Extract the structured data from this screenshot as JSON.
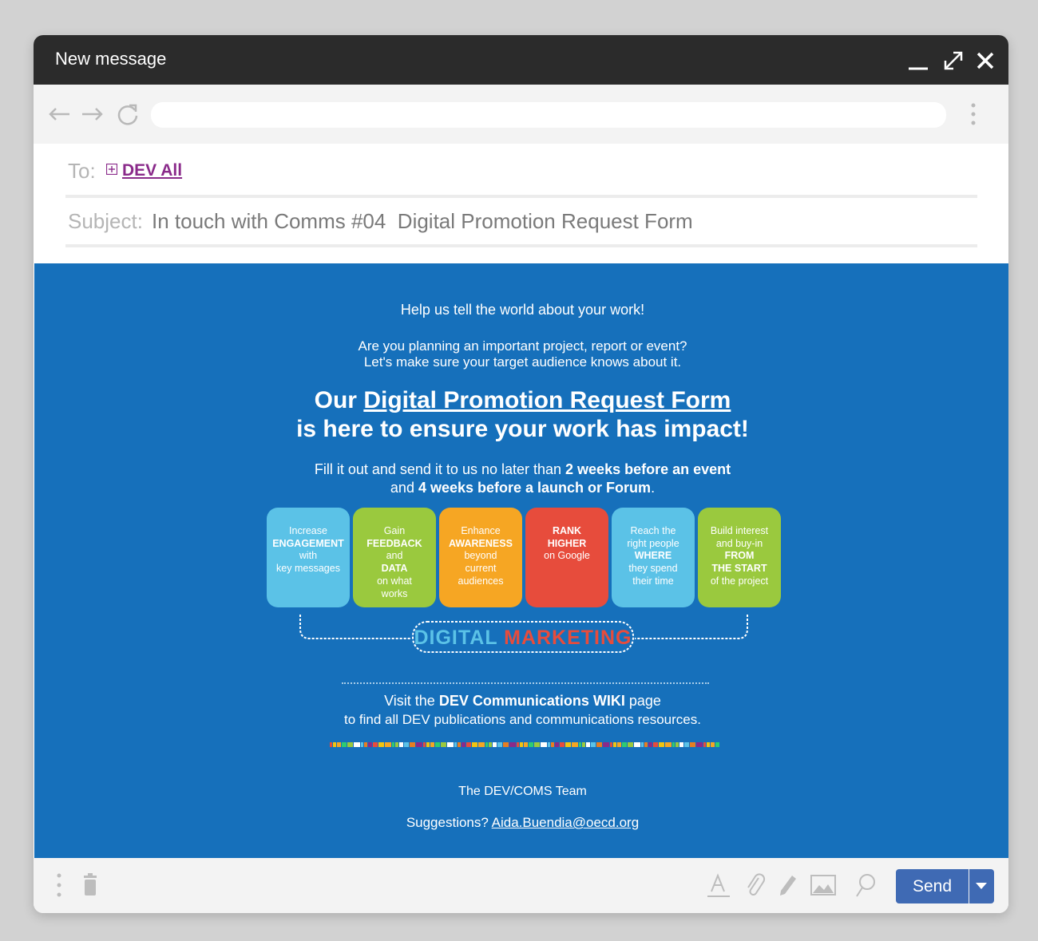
{
  "window": {
    "title": "New message",
    "minimize_icon": "minimize-icon",
    "maximize_icon": "expand-icon",
    "close_icon": "close-icon"
  },
  "nav": {
    "back_icon": "arrow-left-icon",
    "forward_icon": "arrow-right-icon",
    "reload_icon": "reload-icon",
    "address_value": "",
    "more_icon": "kebab-menu-icon"
  },
  "header": {
    "to_label": "To:",
    "recipient": "DEV All",
    "subject_label": "Subject:",
    "subject": "In touch with Comms #04  Digital Promotion Request Form"
  },
  "message": {
    "intro": "Help us tell the world about your work!",
    "question_line1": "Are you planning an important project, report or event?",
    "question_line2": "Let's make sure your target audience knows about it.",
    "headline_prefix": "Our ",
    "headline_link": "Digital Promotion Request Form",
    "headline_line2": "is here to ensure your work has impact!",
    "deadline_line1_pre": "Fill it out and send it to us no later than ",
    "deadline_line1_bold": "2 weeks before an event",
    "deadline_line2_pre": "and ",
    "deadline_line2_bold": "4 weeks before a launch or Forum",
    "deadline_line2_post": ".",
    "cards": [
      {
        "color": "#5bc2e7",
        "lines": [
          "Increase",
          "ENGAGEMENT",
          "with",
          "key messages"
        ]
      },
      {
        "color": "#9ac93e",
        "lines": [
          "Gain",
          "FEEDBACK",
          "and",
          "DATA",
          "on what",
          "works"
        ]
      },
      {
        "color": "#f6a623",
        "lines": [
          "Enhance",
          "AWARENESS",
          "beyond",
          "current",
          "audiences"
        ]
      },
      {
        "color": "#e74c3c",
        "lines": [
          "RANK",
          "HIGHER",
          "on Google"
        ]
      },
      {
        "color": "#5bc2e7",
        "lines": [
          "Reach the",
          "right people",
          "WHERE",
          "they spend",
          "their time"
        ]
      },
      {
        "color": "#9ac93e",
        "lines": [
          "Build interest",
          "and buy-in",
          "FROM",
          "THE START",
          "of the project"
        ]
      }
    ],
    "banner_word1": "DIGITAL",
    "banner_word2": "MARKETING",
    "visit_pre": "Visit the ",
    "visit_bold": "DEV Communications WIKI",
    "visit_post": " page",
    "visit_line2": "to find all DEV publications and communications resources.",
    "signature": "The DEV/COMS Team",
    "suggestions_label": "Suggestions? ",
    "suggestions_email": "Aida.Buendia@oecd.org"
  },
  "footer": {
    "more_icon": "vertical-dots-icon",
    "trash_icon": "trash-icon",
    "format_icon": "text-format-icon",
    "attach_icon": "paperclip-icon",
    "pen_icon": "pen-icon",
    "image_icon": "image-icon",
    "search_icon": "magnifier-icon",
    "send_label": "Send",
    "send_color": "#3f6ab4"
  },
  "colors": {
    "body_blue": "#1670bb",
    "titlebar": "#2b2b2b",
    "recipient": "#8a2a8a"
  }
}
